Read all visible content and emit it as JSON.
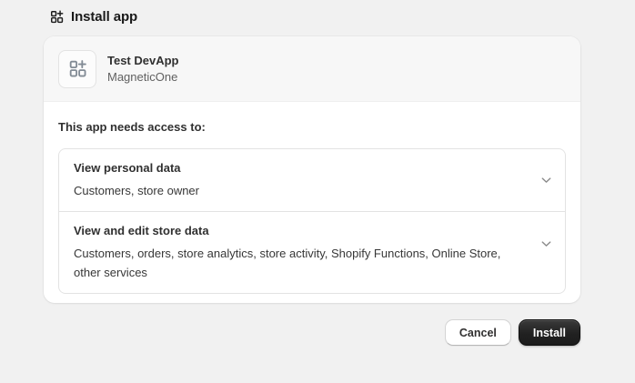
{
  "header": {
    "title": "Install app"
  },
  "app": {
    "name": "Test DevApp",
    "developer": "MagneticOne"
  },
  "access": {
    "heading": "This app needs access to:",
    "permissions": [
      {
        "title": "View personal data",
        "description": "Customers, store owner"
      },
      {
        "title": "View and edit store data",
        "description": "Customers, orders, store analytics, store activity, Shopify Functions, Online Store, other services"
      }
    ]
  },
  "actions": {
    "cancel_label": "Cancel",
    "install_label": "Install"
  },
  "icons": {
    "page": "apps-grid-plus-icon",
    "app_logo": "apps-grid-plus-icon",
    "permission_toggle": "chevron-down-icon"
  },
  "colors": {
    "page_bg": "#f1f1f1",
    "card_bg": "#ffffff",
    "card_header_bg": "#f7f7f7",
    "border": "#e3e3e3",
    "text_primary": "#303030",
    "text_secondary": "#616161",
    "icon_muted": "#828b95",
    "install_button_bg": "#212121",
    "install_button_text": "#ffffff"
  }
}
